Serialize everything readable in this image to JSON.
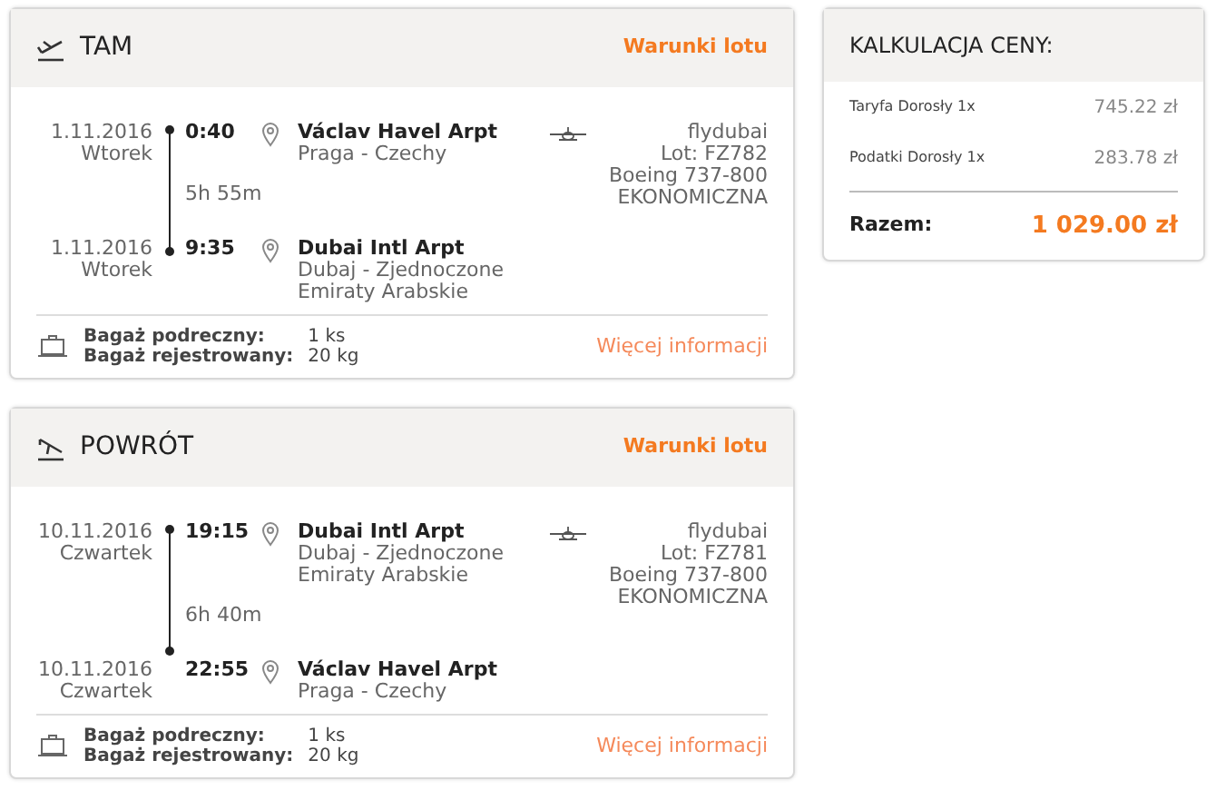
{
  "flights": [
    {
      "kind": "departure",
      "title": "TAM",
      "conditions_link": "Warunki lotu",
      "stops": [
        {
          "date": "1.11.2016",
          "day": "Wtorek",
          "time": "0:40",
          "airport": "Václav Havel Arpt",
          "city": "Praga - Czechy"
        },
        {
          "date": "1.11.2016",
          "day": "Wtorek",
          "time": "9:35",
          "airport": "Dubai Intl Arpt",
          "city": "Dubaj - Zjednoczone Emiraty Arabskie"
        }
      ],
      "duration": "5h 55m",
      "airline": "flydubai",
      "flight_no": "Lot: FZ782",
      "aircraft": "Boeing 737-800",
      "cabin": "EKONOMICZNA",
      "baggage": [
        {
          "label": "Bagaż podreczny:",
          "value": "1 ks"
        },
        {
          "label": "Bagaż rejestrowany:",
          "value": "20 kg"
        }
      ],
      "more_link": "Więcej informacji"
    },
    {
      "kind": "arrival",
      "title": "POWRÓT",
      "conditions_link": "Warunki lotu",
      "stops": [
        {
          "date": "10.11.2016",
          "day": "Czwartek",
          "time": "19:15",
          "airport": "Dubai Intl Arpt",
          "city": "Dubaj - Zjednoczone Emiraty Arabskie"
        },
        {
          "date": "10.11.2016",
          "day": "Czwartek",
          "time": "22:55",
          "airport": "Václav Havel Arpt",
          "city": "Praga - Czechy"
        }
      ],
      "duration": "6h 40m",
      "airline": "flydubai",
      "flight_no": "Lot: FZ781",
      "aircraft": "Boeing 737-800",
      "cabin": "EKONOMICZNA",
      "baggage": [
        {
          "label": "Bagaż podreczny:",
          "value": "1 ks"
        },
        {
          "label": "Bagaż rejestrowany:",
          "value": "20 kg"
        }
      ],
      "more_link": "Więcej informacji"
    }
  ],
  "price": {
    "title": "KALKULACJA CENY:",
    "items": [
      {
        "label": "Taryfa Dorosły 1x",
        "amount": "745.22 zł"
      },
      {
        "label": "Podatki Dorosły 1x",
        "amount": "283.78 zł"
      }
    ],
    "total_label": "Razem:",
    "total": "1 029.00 zł"
  }
}
